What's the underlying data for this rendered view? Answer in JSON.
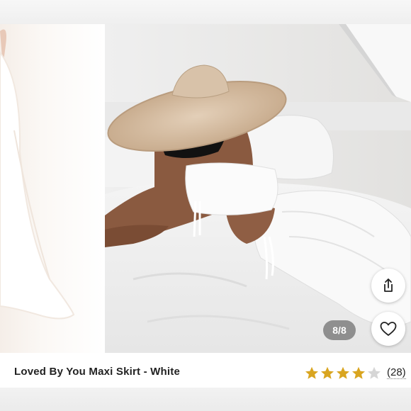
{
  "gallery": {
    "counter": "8/8",
    "main_image_alt": "",
    "share_icon": "share-icon",
    "like_icon": "heart-icon"
  },
  "listing": {
    "title": "Loved By You Maxi Skirt - White",
    "rating": 4,
    "rating_max": 5,
    "review_count": "(28)"
  },
  "colors": {
    "star_filled": "#d9a520",
    "star_empty": "#d6d6d6"
  }
}
